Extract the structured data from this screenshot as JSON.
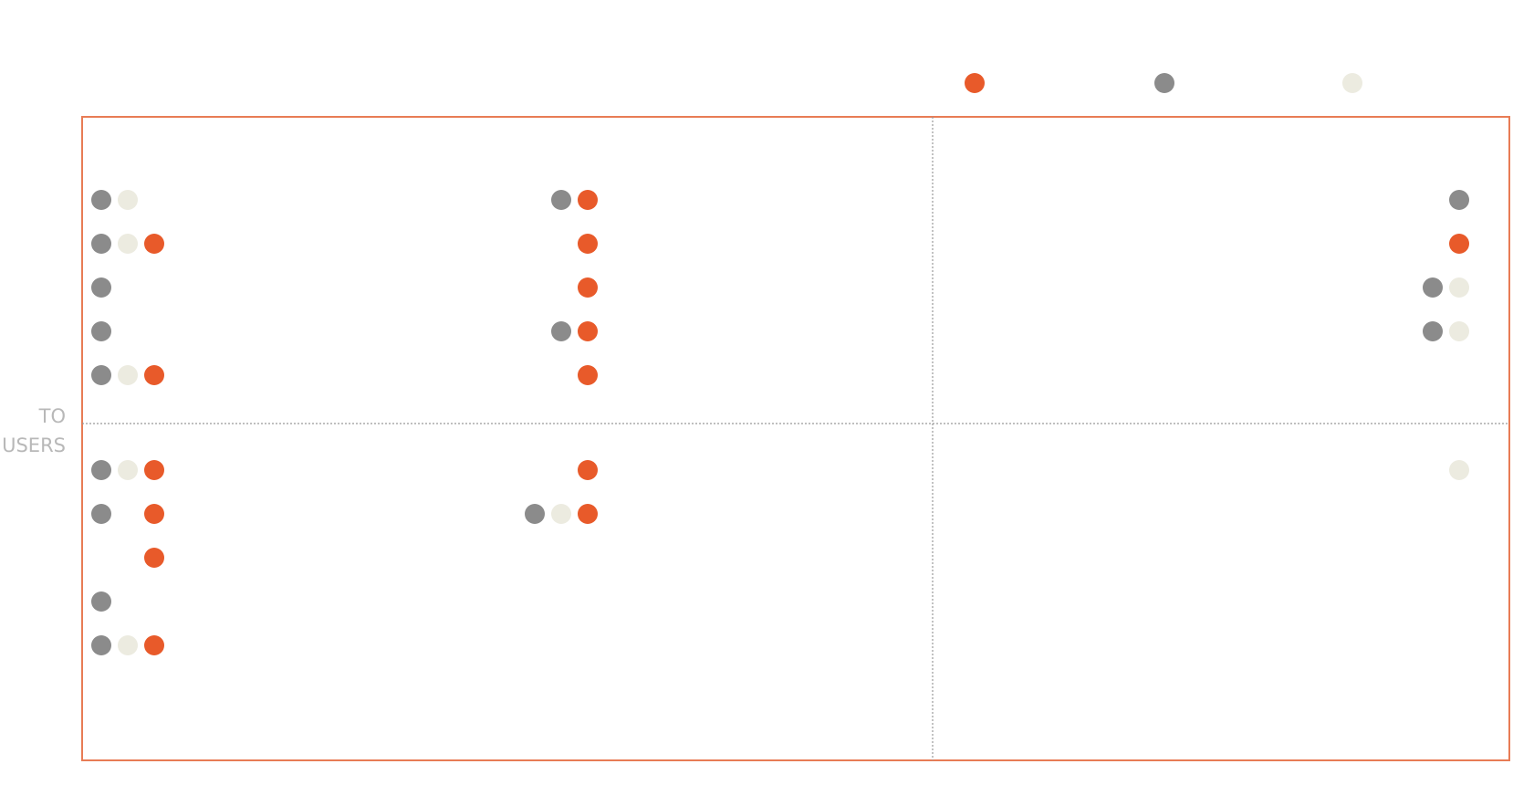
{
  "chart_data": {
    "type": "scatter",
    "ylabel_lines": [
      "TO",
      "USERS"
    ],
    "colors": {
      "orange": "#e85a2a",
      "gray": "#8b8b8b",
      "cream": "#ecebe0",
      "frame": "#e87c55",
      "divider": "#999999"
    },
    "legend_markers": [
      "orange",
      "gray",
      "cream"
    ],
    "quadrants": [
      {
        "column": "left",
        "half": "top",
        "groups": [
          {
            "rows": [
              [
                "gray",
                "cream"
              ],
              [
                "gray",
                "cream",
                "orange"
              ],
              [
                "gray"
              ],
              [
                "gray"
              ],
              [
                "gray",
                "cream",
                "orange"
              ]
            ],
            "align": "start"
          },
          {
            "rows": [
              [
                "gray",
                "orange"
              ],
              [
                "orange"
              ],
              [
                "orange"
              ],
              [
                "gray",
                "orange"
              ],
              [
                "orange"
              ]
            ],
            "align": "end"
          }
        ]
      },
      {
        "column": "right",
        "half": "top",
        "groups": [
          {
            "rows": [
              [
                "gray"
              ],
              [
                "orange"
              ],
              [
                "gray",
                "cream"
              ],
              [
                "gray",
                "cream"
              ]
            ],
            "align": "end"
          }
        ]
      },
      {
        "column": "left",
        "half": "bottom",
        "groups": [
          {
            "rows": [
              [
                "gray",
                "cream",
                "orange"
              ],
              [
                "gray",
                null,
                "orange"
              ],
              [
                null,
                null,
                "orange"
              ],
              [
                "gray"
              ],
              [
                "gray",
                "cream",
                "orange"
              ]
            ],
            "align": "start"
          },
          {
            "rows": [
              [
                "orange"
              ],
              [
                "gray",
                "cream",
                "orange"
              ]
            ],
            "align": "end"
          }
        ]
      },
      {
        "column": "right",
        "half": "bottom",
        "groups": [
          {
            "rows": [
              [
                "cream"
              ]
            ],
            "align": "end"
          }
        ]
      }
    ]
  }
}
